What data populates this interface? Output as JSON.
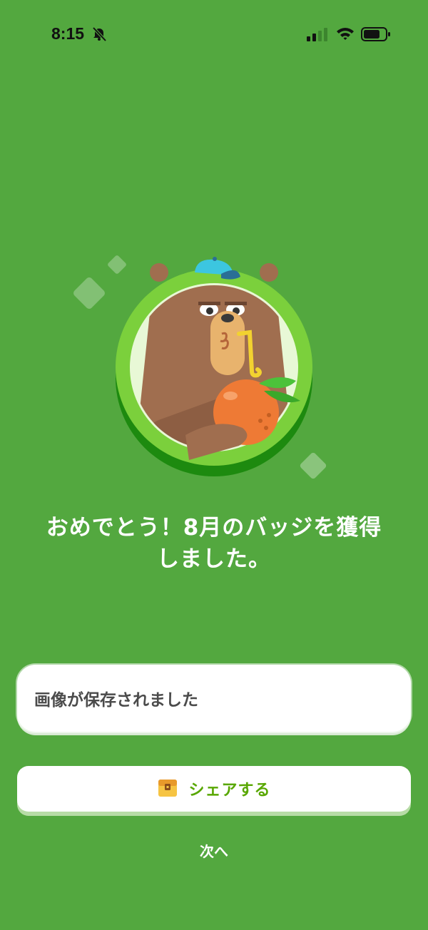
{
  "status_bar": {
    "time": "8:15",
    "icons": [
      "bell-slash-icon",
      "cellular-signal-icon",
      "wifi-icon",
      "battery-icon"
    ]
  },
  "badge": {
    "illustration": "bear-drinking-orange-badge"
  },
  "headline": {
    "line1": "おめでとう！8月のバッジを獲得",
    "line2": "しました。"
  },
  "toast": {
    "message": "画像が保存されました"
  },
  "share_button": {
    "label": "シェアする",
    "icon": "treasure-chest-icon"
  },
  "next_button": {
    "label": "次へ"
  },
  "colors": {
    "background": "#53a83f",
    "share_label": "#58a700",
    "toast_text": "#4b4b4b"
  }
}
